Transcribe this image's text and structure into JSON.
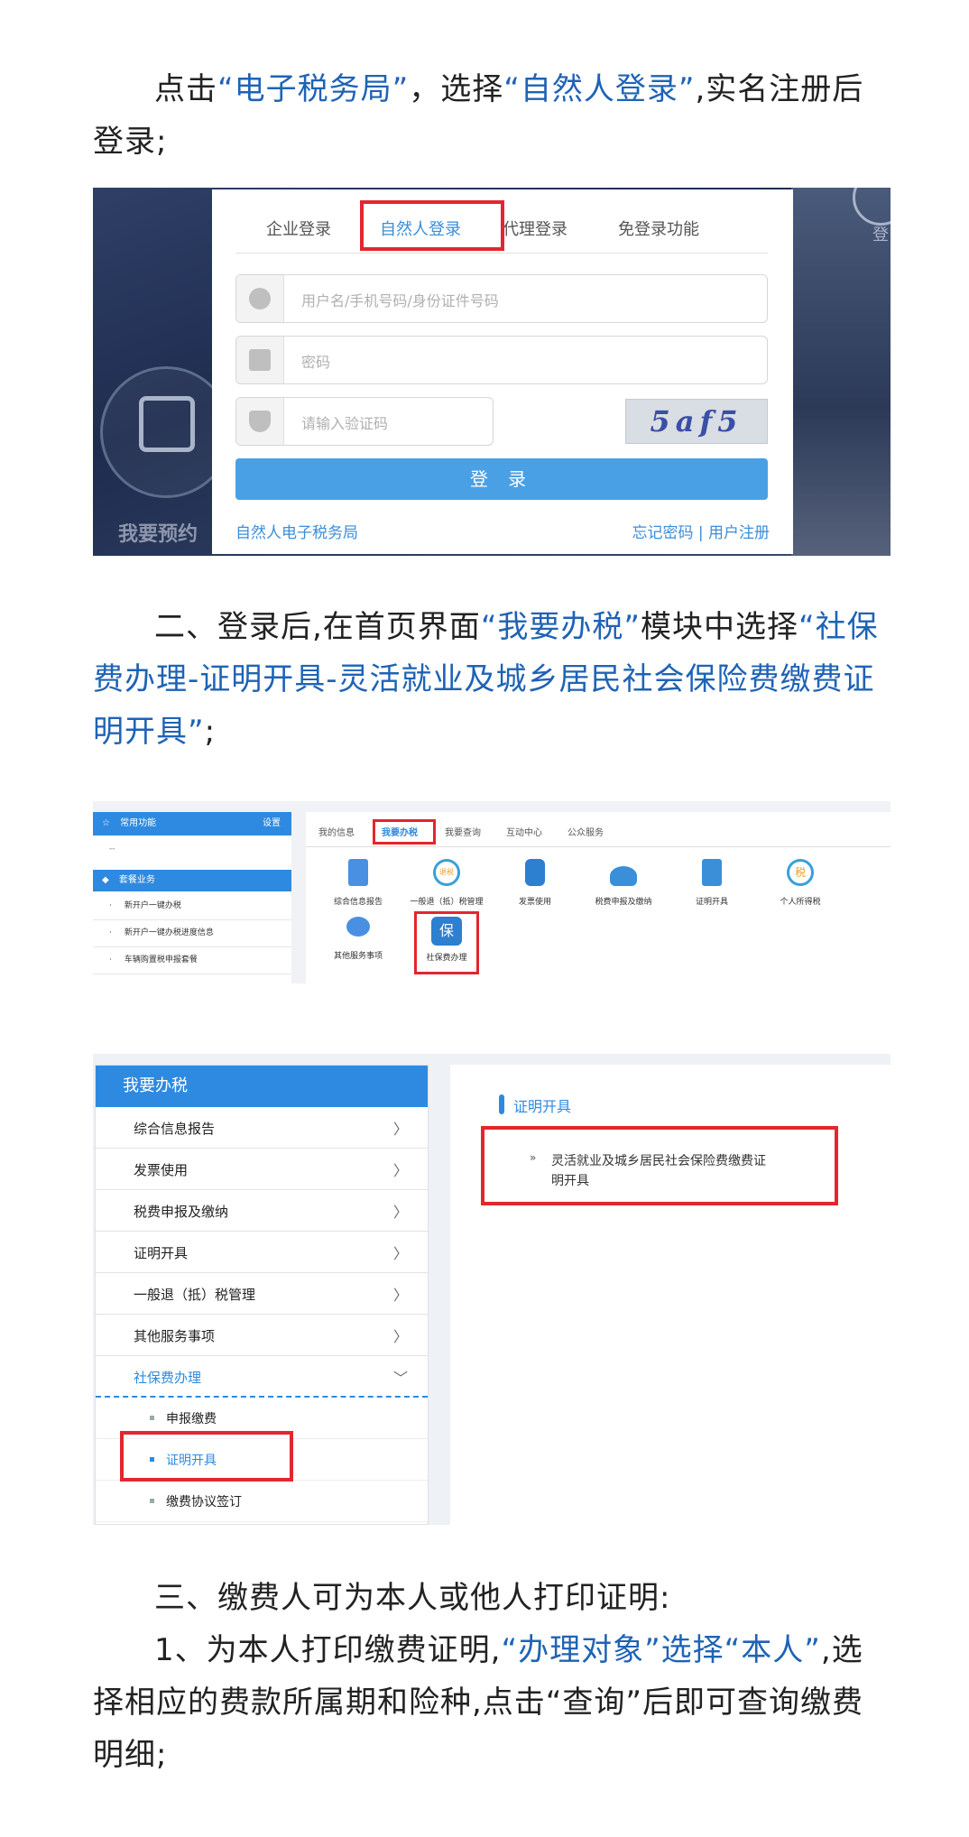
{
  "step1": {
    "text_before": "点击",
    "highlight1": "“电子税务局”",
    "text_mid": "，选择",
    "highlight2": "“自然人登录”",
    "text_after": ",实名注册后登录;"
  },
  "screenshot1": {
    "tabs": [
      "企业登录",
      "自然人登录",
      "代理登录",
      "免登录功能"
    ],
    "username_placeholder": "用户名/手机号码/身份证件号码",
    "password_placeholder": "密码",
    "captcha_placeholder": "请输入验证码",
    "captcha_text": "5af5",
    "login_button": "登 录",
    "footer_left": "自然人电子税务局",
    "footer_right": "忘记密码 | 用户注册",
    "bg_left_label": "我要预约",
    "bg_right_label": "登"
  },
  "step2": {
    "text_before": "二、登录后,在首页界面",
    "highlight1": "“我要办税”",
    "text_mid": "模块中选择",
    "highlight2": "“社保费办理-证明开具-灵活就业及城乡居民社会保险费缴费证明开具”",
    "text_after": ";"
  },
  "screenshot2": {
    "sidebar_header": "常用功能",
    "sidebar_setting": "设置",
    "sidebar_dash": "--",
    "sidebar_section": "套餐业务",
    "sidebar_items": [
      "新开户一键办税",
      "新开户一键办税进度信息",
      "车辆购置税申报套餐"
    ],
    "nav_tabs": [
      "我的信息",
      "我要办税",
      "我要查询",
      "互动中心",
      "公众服务"
    ],
    "tiles": [
      "综合信息报告",
      "一般退（抵）税管理",
      "发票使用",
      "税费申报及缴纳",
      "证明开具",
      "个人所得税",
      "其他服务事项",
      "社保费办理"
    ],
    "tile_icon_text_refund": "退税",
    "tile_icon_text_tax": "税",
    "tile_icon_text_social": "保"
  },
  "screenshot3": {
    "sidebar_header": "我要办税",
    "menu_items": [
      "综合信息报告",
      "发票使用",
      "税费申报及缴纳",
      "证明开具",
      "一般退（抵）税管理",
      "其他服务事项"
    ],
    "menu_arrow": "〉",
    "open_menu": "社保费办理",
    "open_arrow": "﹀",
    "sub_items": [
      "申报缴费",
      "证明开具",
      "缴费协议签订"
    ],
    "section_title": "证明开具",
    "bullet": "»",
    "item_text": "灵活就业及城乡居民社会保险费缴费证明开具"
  },
  "step3": {
    "line1": "三、缴费人可为本人或他人打印证明:",
    "line2_before": "1、为本人打印缴费证明,",
    "line2_h1": "“办理对象”选择“本人”",
    "line2_after": ",选择相应的费款所属期和险种,点击“查询”后即可查询缴费明细;"
  },
  "colors": {
    "accent": "#1f63b5",
    "ui_blue": "#2d8ae0",
    "highlight_red": "#e3262f"
  }
}
